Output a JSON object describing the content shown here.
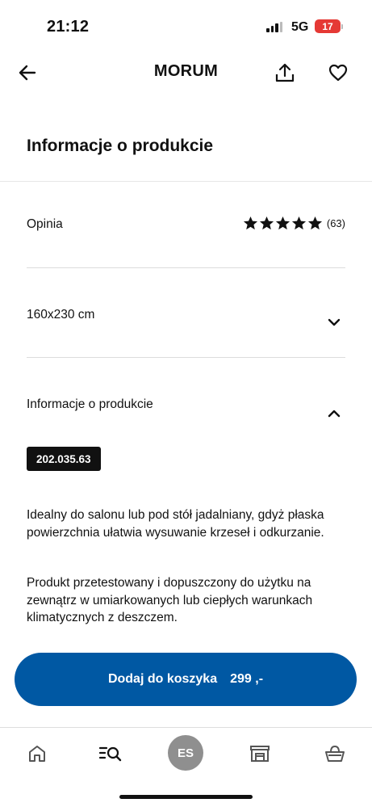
{
  "status_bar": {
    "time": "21:12",
    "network": "5G",
    "battery": "17",
    "battery_color": "#e53935"
  },
  "nav": {
    "title": "MORUM",
    "back_icon": "arrow-left-icon",
    "share_icon": "share-icon",
    "favorite_icon": "heart-icon"
  },
  "page_title": "Informacje o produkcie",
  "rating_row": {
    "label": "Opinia",
    "stars": 5,
    "count": "(63)"
  },
  "size_row": {
    "label": "160x230 cm",
    "expanded": false
  },
  "info_row": {
    "label": "Informacje o produkcie",
    "expanded": true
  },
  "article_number": "202.035.63",
  "paragraphs": [
    "Idealny do salonu lub pod stół jadalniany, gdyż płaska powierzchnia ułatwia wysuwanie krzeseł i odkurzanie.",
    "Produkt przetestowany i dopuszczony do użytku na zewnątrz w umiarkowanych lub ciepłych warunkach klimatycznych z deszczem."
  ],
  "cart_button": {
    "label": "Dodaj do koszyka",
    "price": "299 ,-",
    "color": "#0058a3"
  },
  "tab_bar": {
    "tabs": [
      "home-icon",
      "search-icon",
      "profile-avatar",
      "store-icon",
      "basket-icon"
    ],
    "avatar_initials": "ES"
  }
}
